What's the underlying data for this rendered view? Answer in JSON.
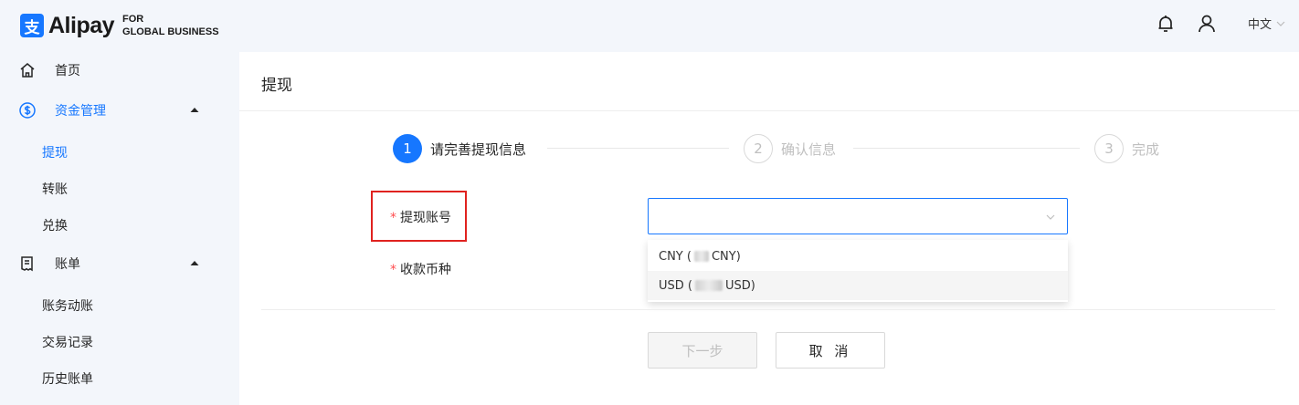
{
  "header": {
    "brand_mark": "支",
    "brand_name": "Alipay",
    "brand_sub_line1": "FOR",
    "brand_sub_line2": "GLOBAL BUSINESS",
    "language": "中文",
    "icons": [
      "bell-icon",
      "user-icon",
      "chevron-down-icon"
    ]
  },
  "sidebar": {
    "items": [
      {
        "label": "首页",
        "icon": "home-icon"
      },
      {
        "label": "资金管理",
        "icon": "dollar-circle-icon",
        "expanded": true,
        "children": [
          {
            "label": "提现",
            "active": true
          },
          {
            "label": "转账"
          },
          {
            "label": "兑换"
          }
        ]
      },
      {
        "label": "账单",
        "icon": "bill-icon",
        "expanded": true,
        "children": [
          {
            "label": "账务动账"
          },
          {
            "label": "交易记录"
          },
          {
            "label": "历史账单"
          }
        ]
      }
    ]
  },
  "main": {
    "title": "提现",
    "steps": [
      {
        "number": "1",
        "label": "请完善提现信息",
        "state": "active"
      },
      {
        "number": "2",
        "label": "确认信息",
        "state": "pending"
      },
      {
        "number": "3",
        "label": "完成",
        "state": "pending"
      }
    ],
    "form": {
      "required_mark": "*",
      "account_label": "提现账号",
      "currency_label": "收款币种",
      "account_value": "",
      "options": [
        {
          "prefix": "CNY (",
          "suffix": "CNY)"
        },
        {
          "prefix": "USD (",
          "suffix": "USD)"
        }
      ]
    },
    "buttons": {
      "next": "下一步",
      "cancel": "取 消"
    }
  },
  "colors": {
    "accent": "#1677ff",
    "required": "#ff4d4f",
    "highlight": "#e0221f",
    "background": "#f3f6fb"
  }
}
